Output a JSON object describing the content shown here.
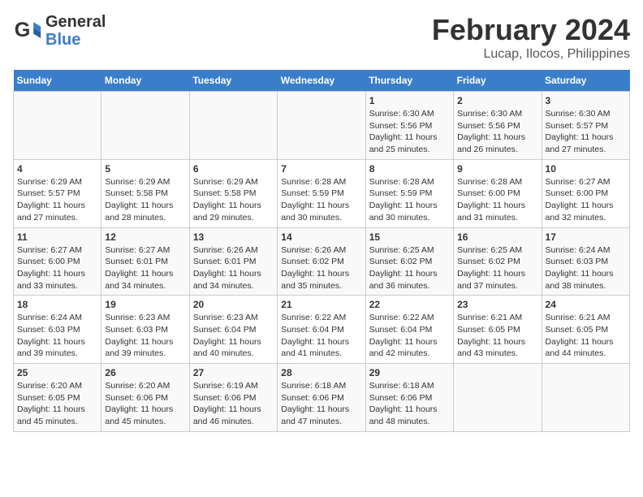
{
  "header": {
    "logo_line1": "General",
    "logo_line2": "Blue",
    "title": "February 2024",
    "subtitle": "Lucap, Ilocos, Philippines"
  },
  "days_of_week": [
    "Sunday",
    "Monday",
    "Tuesday",
    "Wednesday",
    "Thursday",
    "Friday",
    "Saturday"
  ],
  "weeks": [
    [
      {
        "day": "",
        "info": ""
      },
      {
        "day": "",
        "info": ""
      },
      {
        "day": "",
        "info": ""
      },
      {
        "day": "",
        "info": ""
      },
      {
        "day": "1",
        "info": "Sunrise: 6:30 AM\nSunset: 5:56 PM\nDaylight: 11 hours and 25 minutes."
      },
      {
        "day": "2",
        "info": "Sunrise: 6:30 AM\nSunset: 5:56 PM\nDaylight: 11 hours and 26 minutes."
      },
      {
        "day": "3",
        "info": "Sunrise: 6:30 AM\nSunset: 5:57 PM\nDaylight: 11 hours and 27 minutes."
      }
    ],
    [
      {
        "day": "4",
        "info": "Sunrise: 6:29 AM\nSunset: 5:57 PM\nDaylight: 11 hours and 27 minutes."
      },
      {
        "day": "5",
        "info": "Sunrise: 6:29 AM\nSunset: 5:58 PM\nDaylight: 11 hours and 28 minutes."
      },
      {
        "day": "6",
        "info": "Sunrise: 6:29 AM\nSunset: 5:58 PM\nDaylight: 11 hours and 29 minutes."
      },
      {
        "day": "7",
        "info": "Sunrise: 6:28 AM\nSunset: 5:59 PM\nDaylight: 11 hours and 30 minutes."
      },
      {
        "day": "8",
        "info": "Sunrise: 6:28 AM\nSunset: 5:59 PM\nDaylight: 11 hours and 30 minutes."
      },
      {
        "day": "9",
        "info": "Sunrise: 6:28 AM\nSunset: 6:00 PM\nDaylight: 11 hours and 31 minutes."
      },
      {
        "day": "10",
        "info": "Sunrise: 6:27 AM\nSunset: 6:00 PM\nDaylight: 11 hours and 32 minutes."
      }
    ],
    [
      {
        "day": "11",
        "info": "Sunrise: 6:27 AM\nSunset: 6:00 PM\nDaylight: 11 hours and 33 minutes."
      },
      {
        "day": "12",
        "info": "Sunrise: 6:27 AM\nSunset: 6:01 PM\nDaylight: 11 hours and 34 minutes."
      },
      {
        "day": "13",
        "info": "Sunrise: 6:26 AM\nSunset: 6:01 PM\nDaylight: 11 hours and 34 minutes."
      },
      {
        "day": "14",
        "info": "Sunrise: 6:26 AM\nSunset: 6:02 PM\nDaylight: 11 hours and 35 minutes."
      },
      {
        "day": "15",
        "info": "Sunrise: 6:25 AM\nSunset: 6:02 PM\nDaylight: 11 hours and 36 minutes."
      },
      {
        "day": "16",
        "info": "Sunrise: 6:25 AM\nSunset: 6:02 PM\nDaylight: 11 hours and 37 minutes."
      },
      {
        "day": "17",
        "info": "Sunrise: 6:24 AM\nSunset: 6:03 PM\nDaylight: 11 hours and 38 minutes."
      }
    ],
    [
      {
        "day": "18",
        "info": "Sunrise: 6:24 AM\nSunset: 6:03 PM\nDaylight: 11 hours and 39 minutes."
      },
      {
        "day": "19",
        "info": "Sunrise: 6:23 AM\nSunset: 6:03 PM\nDaylight: 11 hours and 39 minutes."
      },
      {
        "day": "20",
        "info": "Sunrise: 6:23 AM\nSunset: 6:04 PM\nDaylight: 11 hours and 40 minutes."
      },
      {
        "day": "21",
        "info": "Sunrise: 6:22 AM\nSunset: 6:04 PM\nDaylight: 11 hours and 41 minutes."
      },
      {
        "day": "22",
        "info": "Sunrise: 6:22 AM\nSunset: 6:04 PM\nDaylight: 11 hours and 42 minutes."
      },
      {
        "day": "23",
        "info": "Sunrise: 6:21 AM\nSunset: 6:05 PM\nDaylight: 11 hours and 43 minutes."
      },
      {
        "day": "24",
        "info": "Sunrise: 6:21 AM\nSunset: 6:05 PM\nDaylight: 11 hours and 44 minutes."
      }
    ],
    [
      {
        "day": "25",
        "info": "Sunrise: 6:20 AM\nSunset: 6:05 PM\nDaylight: 11 hours and 45 minutes."
      },
      {
        "day": "26",
        "info": "Sunrise: 6:20 AM\nSunset: 6:06 PM\nDaylight: 11 hours and 45 minutes."
      },
      {
        "day": "27",
        "info": "Sunrise: 6:19 AM\nSunset: 6:06 PM\nDaylight: 11 hours and 46 minutes."
      },
      {
        "day": "28",
        "info": "Sunrise: 6:18 AM\nSunset: 6:06 PM\nDaylight: 11 hours and 47 minutes."
      },
      {
        "day": "29",
        "info": "Sunrise: 6:18 AM\nSunset: 6:06 PM\nDaylight: 11 hours and 48 minutes."
      },
      {
        "day": "",
        "info": ""
      },
      {
        "day": "",
        "info": ""
      }
    ]
  ]
}
